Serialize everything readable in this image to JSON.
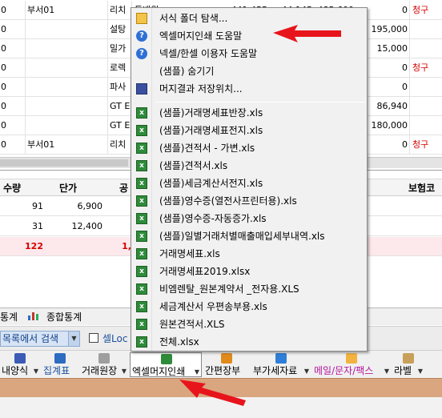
{
  "top_rows": [
    {
      "c1": "0",
      "c2": "부서01",
      "c3": "리치",
      "c3b": "통배위",
      "nums": [
        "441,455",
        "44,145",
        "485,600"
      ],
      "c4": "0",
      "c5": "청구"
    },
    {
      "c1": "0",
      "c2": "",
      "c3": "설탕",
      "c4": "195,000",
      "c5": ""
    },
    {
      "c1": "0",
      "c2": "",
      "c3": "밀가",
      "c4": "15,000",
      "c5": ""
    },
    {
      "c1": "0",
      "c2": "",
      "c3": "로렉",
      "c4": "0",
      "c5": "청구"
    },
    {
      "c1": "0",
      "c2": "",
      "c3": "파사",
      "c4": "0",
      "c5": ""
    },
    {
      "c1": "0",
      "c2": "",
      "c3": "GT E",
      "c4": "86,940",
      "c5": ""
    },
    {
      "c1": "0",
      "c2": "",
      "c3": "GT E",
      "c4": "180,000",
      "c5": ""
    },
    {
      "c1": "0",
      "c2": "부서01",
      "c3": "리치",
      "c4": "0",
      "c5": "청구"
    }
  ],
  "bottom_grid": {
    "headers": {
      "qty": "수량",
      "price": "단가",
      "supply": "공",
      "insurance": "보험코"
    },
    "rows": [
      {
        "qty": "91",
        "price": "6,900",
        "supply": ""
      },
      {
        "qty": "31",
        "price": "12,400",
        "supply": ""
      }
    ],
    "total": {
      "qty": "122",
      "price": "",
      "supply": "1,"
    }
  },
  "tabs": {
    "stats": "통계",
    "total_stats": "종합통계"
  },
  "search": {
    "combo_label": "목록에서 검색",
    "check_label": "셀Loc"
  },
  "toolbar": [
    {
      "label": "내양식",
      "dropdown": true,
      "color": "#000000",
      "icon": "print-icon"
    },
    {
      "label": "집계표",
      "dropdown": false,
      "color": "#1b50a0",
      "icon": "bar-chart-icon"
    },
    {
      "label": "거래원장",
      "dropdown": true,
      "color": "#000000",
      "icon": "ledger-icon"
    },
    {
      "label": "엑셀머지인쇄",
      "dropdown": true,
      "color": "#000000",
      "icon": "excel-icon"
    },
    {
      "label": "간편장부",
      "dropdown": false,
      "color": "#000000",
      "icon": "book-icon"
    },
    {
      "label": "부가세자료",
      "dropdown": true,
      "color": "#000000",
      "icon": "home-icon"
    },
    {
      "label": "메일/문자/팩스",
      "dropdown": true,
      "color": "#b5179e",
      "icon": "mail-icon"
    },
    {
      "label": "라벨",
      "dropdown": true,
      "color": "#000000",
      "icon": "label-icon"
    }
  ],
  "menu": {
    "top_items": [
      {
        "label": "서식 폴더 탐색...",
        "icon": "folder-icon"
      },
      {
        "label": "엑셀머지인쇄 도움말",
        "icon": "help-icon"
      },
      {
        "label": "넥셀/한셀 이용자 도움말",
        "icon": "help-icon"
      },
      {
        "label": "(샘플) 숨기기",
        "icon": ""
      },
      {
        "label": "머지결과 저장위치...",
        "icon": "save-icon"
      }
    ],
    "file_items": [
      "(샘플)거래명세표반장.xls",
      "(샘플)거래명세표전지.xls",
      "(샘플)견적서 - 가변.xls",
      "(샘플)견적서.xls",
      "(샘플)세금계산서전지.xls",
      "(샘플)영수증(열전사프린터용).xls",
      "(샘플)영수증-자동증가.xls",
      "(샘플)일별거래처별매출매입세부내역.xls",
      "거래명세표.xls",
      "거래명세표2019.xlsx",
      "비엠렌탈_원본계약서 _전자용.XLS",
      "세금계산서 우편송부용.xls",
      "원본견적서.XLS",
      "전체.xlsx"
    ]
  },
  "colors": {
    "accent_red": "#e8141b",
    "claim_red": "#d40000",
    "status_strip": "#d9a680"
  }
}
